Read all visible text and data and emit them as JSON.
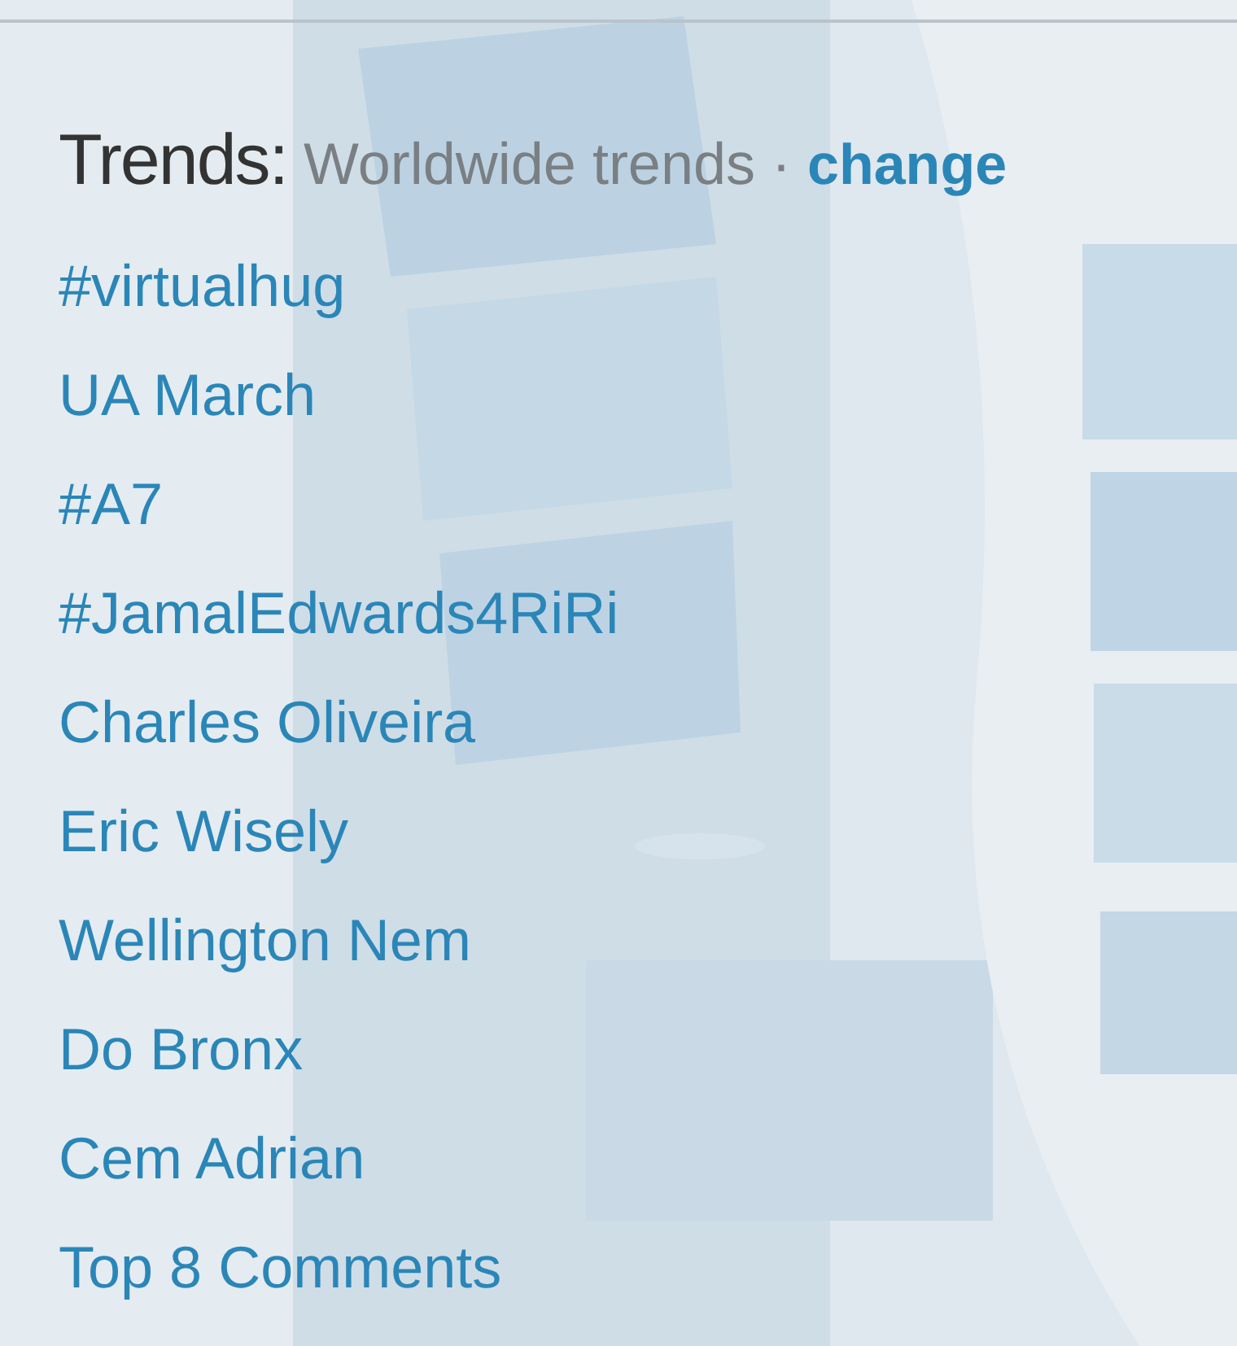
{
  "trends": {
    "title": "Trends:",
    "subtitle": "Worldwide trends",
    "separator": "·",
    "change_link": "change",
    "items": [
      {
        "label": "#virtualhug"
      },
      {
        "label": "UA March"
      },
      {
        "label": "#A7"
      },
      {
        "label": "#JamalEdwards4RiRi"
      },
      {
        "label": "Charles Oliveira"
      },
      {
        "label": "Eric Wisely"
      },
      {
        "label": "Wellington Nem"
      },
      {
        "label": "Do Bronx"
      },
      {
        "label": "Cem Adrian"
      },
      {
        "label": "Top 8 Comments"
      }
    ]
  }
}
